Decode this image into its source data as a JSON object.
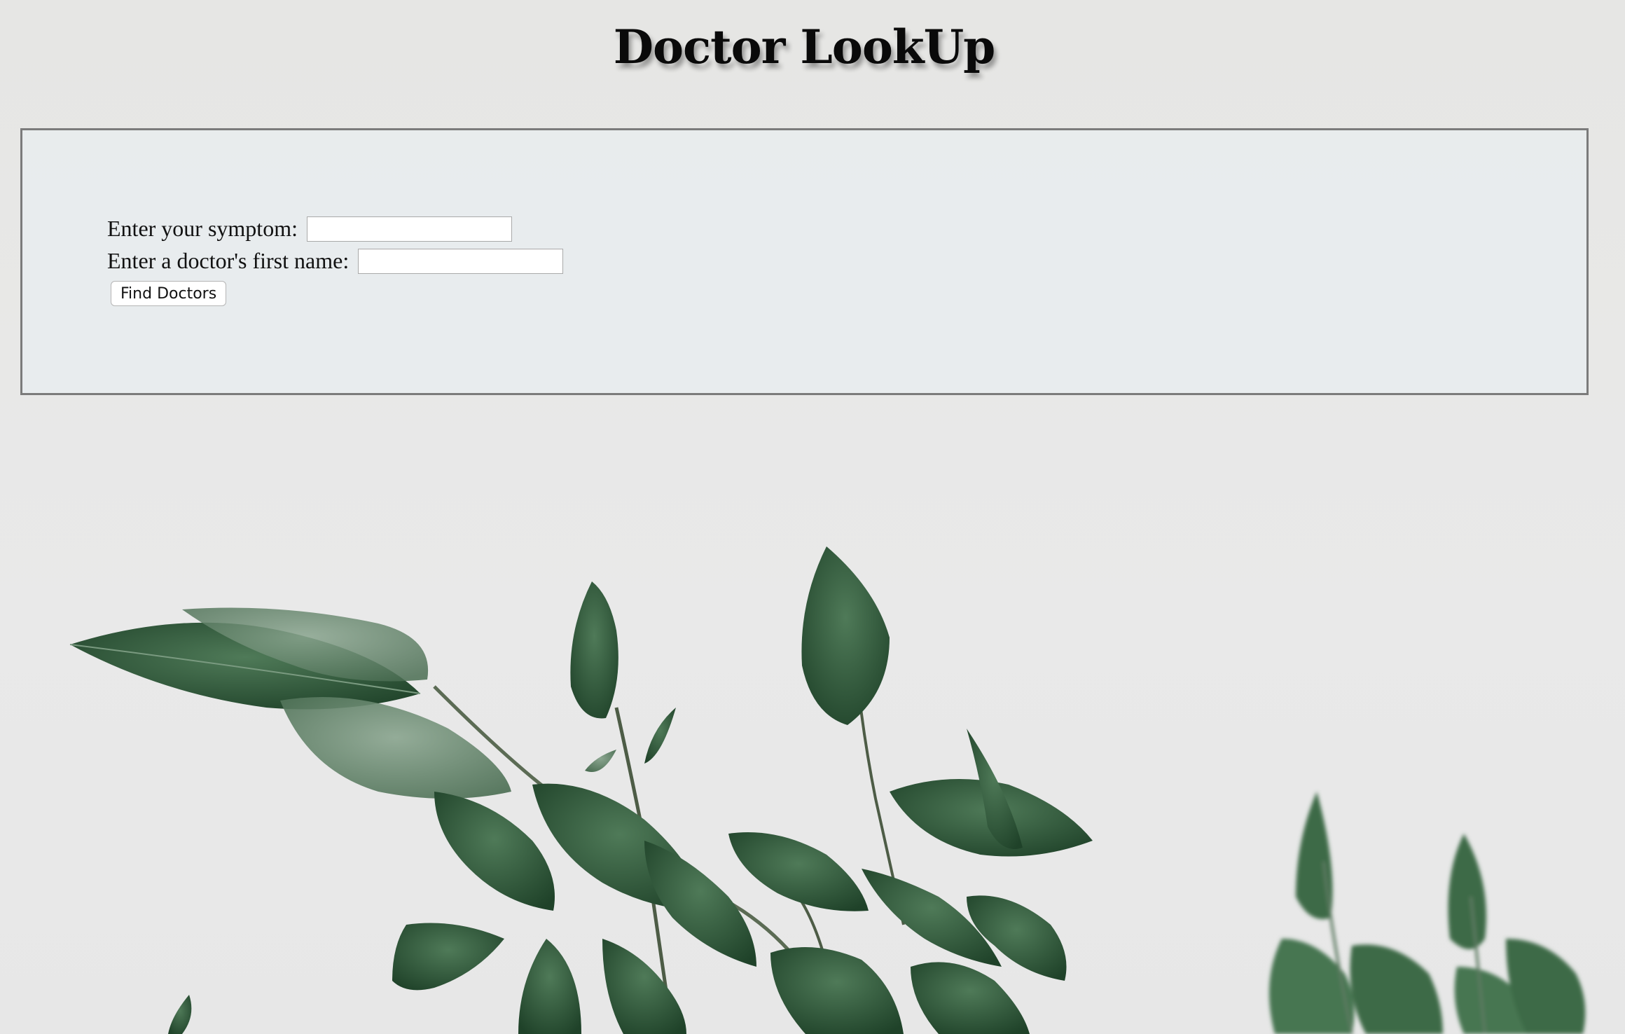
{
  "page": {
    "title": "Doctor LookUp"
  },
  "form": {
    "symptom_label": "Enter your symptom:",
    "symptom_value": "",
    "name_label": "Enter a doctor's first name:",
    "name_value": "",
    "submit_label": "Find Doctors"
  },
  "background": {
    "image": "green-leaves-photo",
    "leaf_color": "#2f5a3a"
  }
}
